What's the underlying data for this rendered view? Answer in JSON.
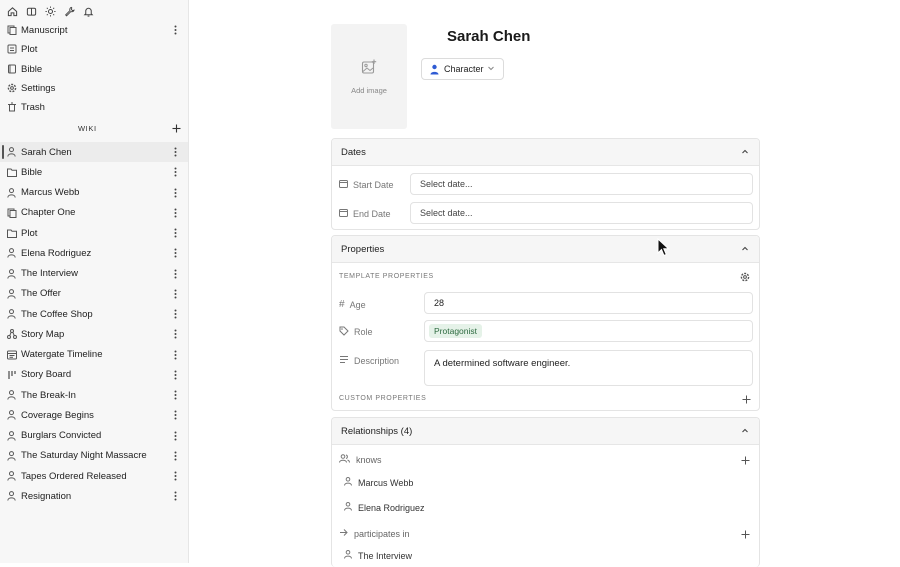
{
  "sidebar": {
    "top_icons": [
      "home-icon",
      "book-open-icon",
      "sun-icon",
      "wrench-icon",
      "bell-icon"
    ],
    "nav": [
      {
        "label": "Manuscript",
        "icon": "manuscript-icon"
      },
      {
        "label": "Plot",
        "icon": "plot-icon"
      },
      {
        "label": "Bible",
        "icon": "bible-icon"
      },
      {
        "label": "Settings",
        "icon": "gear-icon"
      },
      {
        "label": "Trash",
        "icon": "trash-icon"
      }
    ],
    "wiki_label": "WIKI",
    "wiki_items": [
      {
        "label": "Sarah Chen",
        "icon": "person-icon"
      },
      {
        "label": "Bible",
        "icon": "folder-icon"
      },
      {
        "label": "Marcus Webb",
        "icon": "person-icon"
      },
      {
        "label": "Chapter One",
        "icon": "chapter-icon"
      },
      {
        "label": "Plot",
        "icon": "folder-icon"
      },
      {
        "label": "Elena Rodriguez",
        "icon": "person-icon"
      },
      {
        "label": "The Interview",
        "icon": "person-icon"
      },
      {
        "label": "The Offer",
        "icon": "person-icon"
      },
      {
        "label": "The Coffee Shop",
        "icon": "person-icon"
      },
      {
        "label": "Story Map",
        "icon": "map-icon"
      },
      {
        "label": "Watergate Timeline",
        "icon": "timeline-icon"
      },
      {
        "label": "Story Board",
        "icon": "board-icon"
      },
      {
        "label": "The Break-In",
        "icon": "person-icon"
      },
      {
        "label": "Coverage Begins",
        "icon": "person-icon"
      },
      {
        "label": "Burglars Convicted",
        "icon": "person-icon"
      },
      {
        "label": "The Saturday Night Massacre",
        "icon": "person-icon"
      },
      {
        "label": "Tapes Ordered Released",
        "icon": "person-icon"
      },
      {
        "label": "Resignation",
        "icon": "person-icon"
      }
    ]
  },
  "entity": {
    "title": "Sarah Chen",
    "add_image_label": "Add image",
    "type_label": "Character"
  },
  "dates": {
    "header": "Dates",
    "start_label": "Start Date",
    "start_placeholder": "Select date...",
    "end_label": "End Date",
    "end_placeholder": "Select date..."
  },
  "properties": {
    "header": "Properties",
    "template_label": "TEMPLATE PROPERTIES",
    "age_label": "Age",
    "age_value": "28",
    "role_label": "Role",
    "role_value": "Protagonist",
    "description_label": "Description",
    "description_value": "A determined software engineer.",
    "custom_label": "CUSTOM PROPERTIES"
  },
  "relationships": {
    "header": "Relationships (4)",
    "groups": [
      {
        "label": "knows",
        "items": [
          "Marcus Webb",
          "Elena Rodriguez"
        ]
      },
      {
        "label": "participates in",
        "items": [
          "The Interview"
        ]
      }
    ]
  },
  "colors": {
    "accent_blue": "#2f5bd3",
    "tag_bg": "#e5f2e8",
    "tag_text": "#2e6b40"
  }
}
